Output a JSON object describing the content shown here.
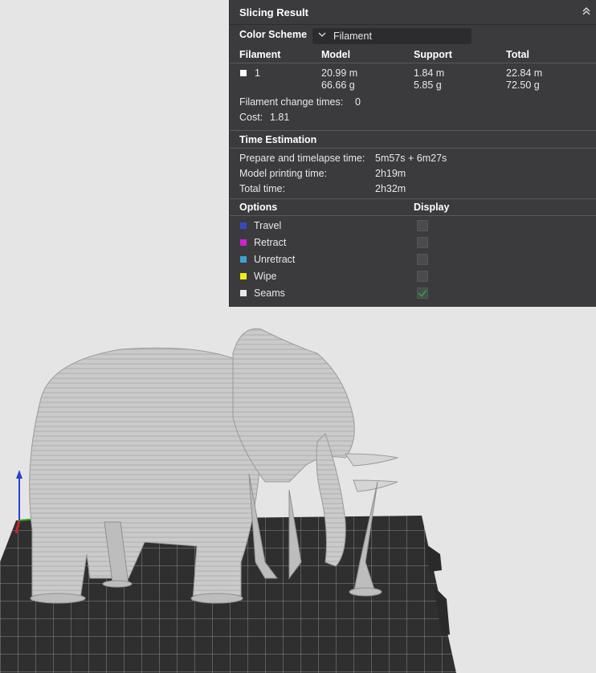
{
  "panel": {
    "title": "Slicing Result",
    "color_scheme": {
      "label": "Color Scheme",
      "value": "Filament"
    },
    "filament_table": {
      "headers": [
        "Filament",
        "Model",
        "Support",
        "Total"
      ],
      "rows": [
        {
          "id": "1",
          "swatch_color": "#ffffff",
          "model_length": "20.99 m",
          "model_weight": "66.66 g",
          "support_length": "1.84 m",
          "support_weight": "5.85 g",
          "total_length": "22.84 m",
          "total_weight": "72.50 g"
        }
      ]
    },
    "filament_change": {
      "label": "Filament change times:",
      "value": "0"
    },
    "cost": {
      "label": "Cost:",
      "value": "1.81"
    },
    "time_estimation": {
      "title": "Time Estimation",
      "rows": [
        {
          "label": "Prepare and timelapse time:",
          "value": "5m57s + 6m27s"
        },
        {
          "label": "Model printing time:",
          "value": "2h19m"
        },
        {
          "label": "Total time:",
          "value": "2h32m"
        }
      ]
    },
    "options": {
      "header": "Options",
      "display_header": "Display",
      "items": [
        {
          "label": "Travel",
          "color": "#3b45c5",
          "checked": false
        },
        {
          "label": "Retract",
          "color": "#d21fd2",
          "checked": false
        },
        {
          "label": "Unretract",
          "color": "#3aa3d2",
          "checked": false
        },
        {
          "label": "Wipe",
          "color": "#f0ee12",
          "checked": false
        },
        {
          "label": "Seams",
          "color": "#e8e8e8",
          "checked": true
        }
      ]
    }
  },
  "viewport": {
    "background": "#e5e5e5",
    "plate_color": "#2f2f2f",
    "model_color": "#c9c9c9"
  }
}
